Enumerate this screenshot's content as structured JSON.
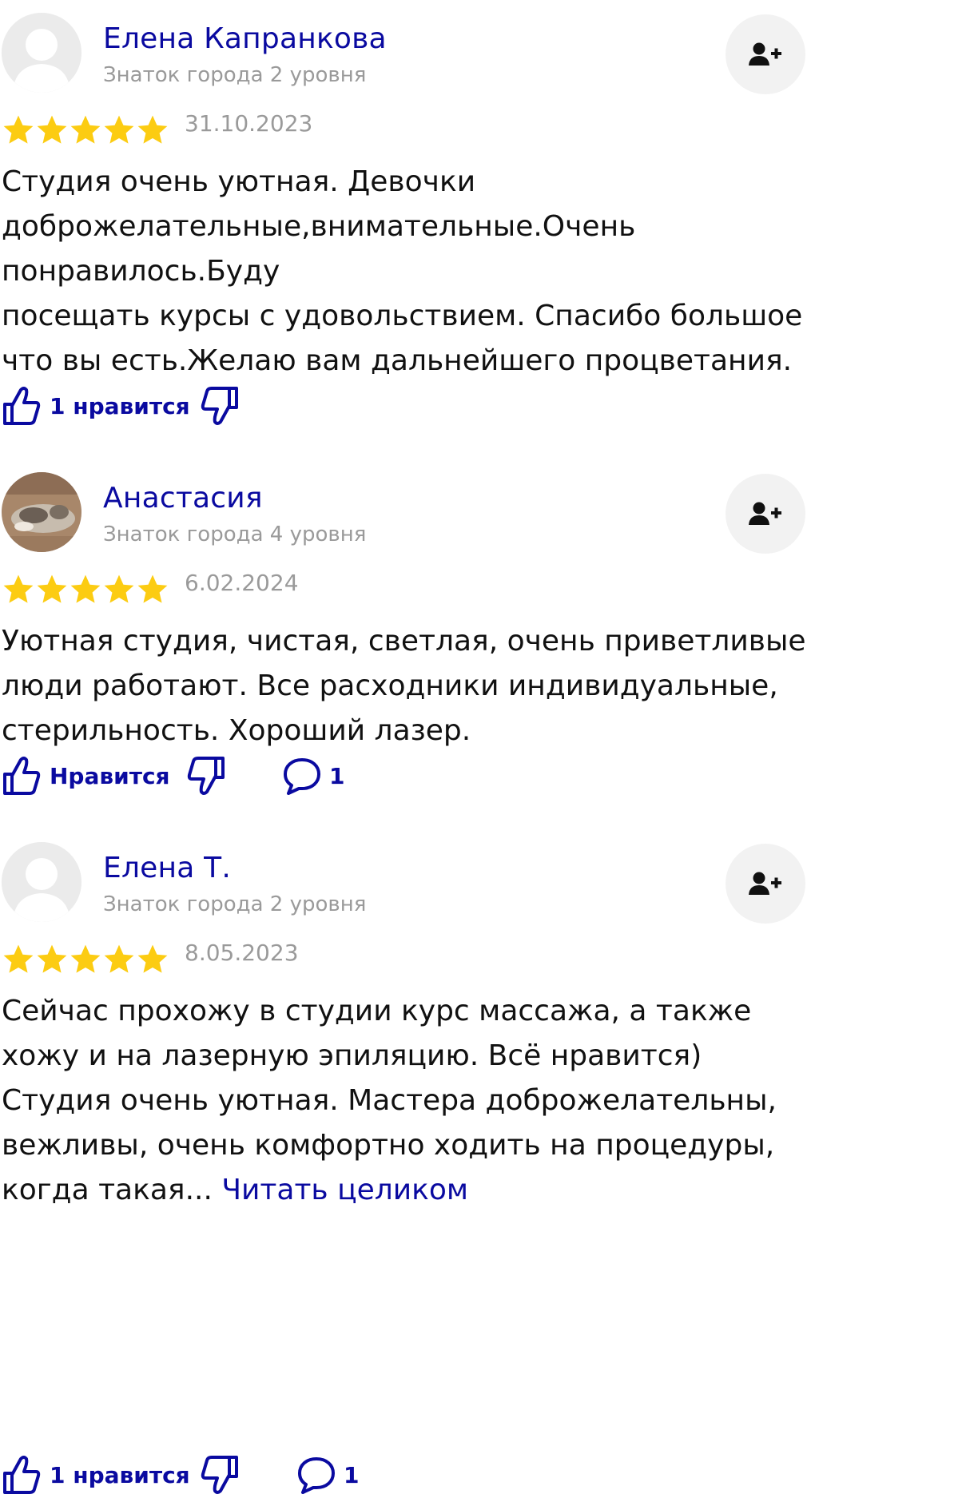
{
  "colors": {
    "accent": "#0a0aa0",
    "star": "#fccc12",
    "muted": "#9a9a9a",
    "button_bg": "#f2f2f2"
  },
  "reviews": [
    {
      "author": "Елена Капранкова",
      "level": "Знаток города 2 уровня",
      "rating": 5,
      "date": "31.10.2023",
      "text": "Студия очень уютная. Девочки\nдоброжелательные,внимательные.Очень\nпонравилось.Буду\nпосещать курсы с удовольствием. Спасибо большое\nчто вы есть.Желаю вам дальнейшего процветания.",
      "like_label": "1 нравится",
      "avatar_icon": "default-avatar-icon"
    },
    {
      "author": "Анастасия",
      "level": "Знаток города 4 уровня",
      "rating": 5,
      "date": "6.02.2024",
      "text": "Уютная студия, чистая, светлая, очень приветливые\nлюди работают. Все расходники индивидуальные,\nстерильность. Хороший лазер.",
      "like_label": "Нравится",
      "comments_count": "1",
      "avatar_icon": "cat-photo-avatar"
    },
    {
      "author": "Елена Т.",
      "level": "Знаток города 2 уровня",
      "rating": 5,
      "date": "8.05.2023",
      "text": "Сейчас прохожу в студии курс массажа, а также\nхожу и на лазерную эпиляцию. Всё нравится)\nСтудия очень уютная. Мастера доброжелательны,\nвежливы, очень комфортно ходить на процедуры,\nкогда такая... ",
      "read_more": "Читать целиком",
      "like_label": "1 нравится",
      "comments_count": "1",
      "avatar_icon": "default-avatar-icon"
    }
  ]
}
